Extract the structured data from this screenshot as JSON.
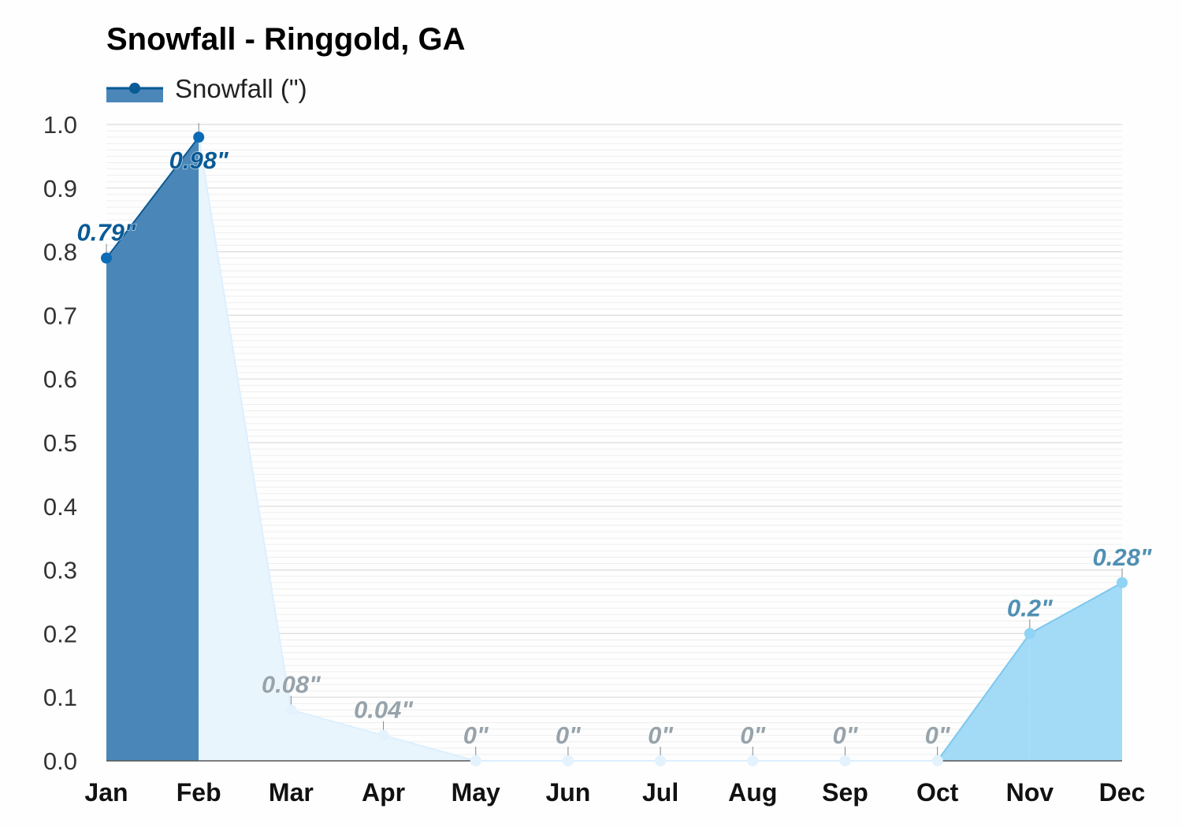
{
  "chart_data": {
    "type": "area",
    "title": "Snowfall - Ringgold, GA",
    "xlabel": "",
    "ylabel": "",
    "ylim": [
      0,
      1.0
    ],
    "yticks": [
      "0.0",
      "0.1",
      "0.2",
      "0.3",
      "0.4",
      "0.5",
      "0.6",
      "0.7",
      "0.8",
      "0.9",
      "1.0"
    ],
    "grid": true,
    "legend": {
      "position": "top-left",
      "entries": [
        "Snowfall (\")"
      ]
    },
    "categories": [
      "Jan",
      "Feb",
      "Mar",
      "Apr",
      "May",
      "Jun",
      "Jul",
      "Aug",
      "Sep",
      "Oct",
      "Nov",
      "Dec"
    ],
    "series": [
      {
        "name": "Snowfall (\")",
        "values": [
          0.79,
          0.98,
          0.08,
          0.04,
          0,
          0,
          0,
          0,
          0,
          0,
          0.2,
          0.28
        ],
        "data_labels": [
          "0.79\"",
          "0.98\"",
          "0.08\"",
          "0.04\"",
          "0\"",
          "0\"",
          "0\"",
          "0\"",
          "0\"",
          "0\"",
          "0.2\"",
          "0.28\""
        ]
      }
    ],
    "segment_colors": {
      "winter_fill": "#4a87b8",
      "winter_line": "#0a5a96",
      "winter_point": "#0b6bb5",
      "winter_label": "#0a5a96",
      "off_fill": "#e8f5fd",
      "off_line": "#dcefff",
      "off_point": "#e3f2fc",
      "off_label": "#97a3ab",
      "late_fill": "#a3daf6",
      "late_line": "#7cc8f0",
      "late_point": "#8fd3f5",
      "late_label": "#5090b3"
    }
  }
}
